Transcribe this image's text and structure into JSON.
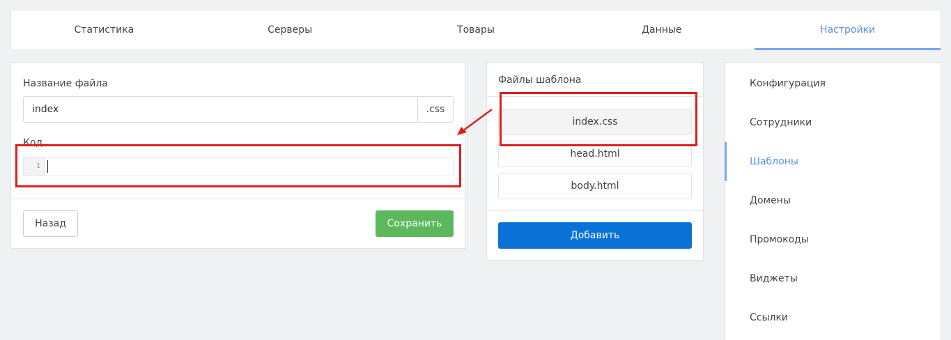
{
  "nav": {
    "tabs": [
      "Статистика",
      "Серверы",
      "Товары",
      "Данные",
      "Настройки"
    ],
    "active": "Настройки"
  },
  "editor": {
    "filename_label": "Название файла",
    "filename_value": "index",
    "extension": ".css",
    "code_label": "Код",
    "line_number": "1",
    "back_label": "Назад",
    "save_label": "Сохранить"
  },
  "files": {
    "title": "Файлы шаблона",
    "items": [
      "index.css",
      "head.html",
      "body.html"
    ],
    "selected": "index.css",
    "add_label": "Добавить"
  },
  "sidebar": {
    "items": [
      "Конфигурация",
      "Сотрудники",
      "Шаблоны",
      "Домены",
      "Промокоды",
      "Виджеты",
      "Ссылки"
    ],
    "active": "Шаблоны"
  },
  "colors": {
    "accent": "#7aa4ef",
    "save": "#5cb85c",
    "add": "#0a72d6",
    "annotation": "#e01e1e"
  }
}
